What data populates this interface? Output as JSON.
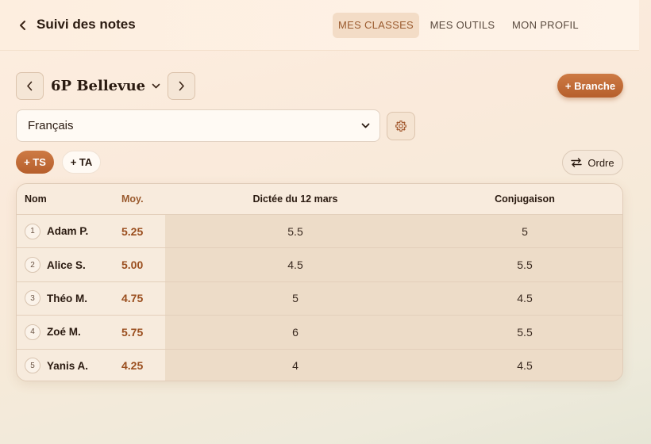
{
  "header": {
    "back_icon": "chevron-left-icon",
    "title": "Suivi des notes",
    "nav": [
      {
        "label": "MES CLASSES",
        "active": true
      },
      {
        "label": "MES OUTILS",
        "active": false
      },
      {
        "label": "MON PROFIL",
        "active": false
      }
    ]
  },
  "class_bar": {
    "class_name": "6P Bellevue",
    "prev_icon": "chevron-left-icon",
    "next_icon": "chevron-right-icon",
    "dropdown_icon": "chevron-down-icon",
    "add_branch_label": "+ Branche"
  },
  "subject": {
    "selected": "Français",
    "settings_icon": "gear-icon"
  },
  "filters": {
    "ts_label": "+ TS",
    "ta_label": "+ TA",
    "order_label": "Ordre",
    "order_icon": "swap-arrows-icon"
  },
  "table": {
    "columns": [
      "Nom",
      "Moy.",
      "Dictée du 12 mars",
      "Conjugaison"
    ],
    "rows": [
      {
        "num": "1",
        "name": "Adam P.",
        "avg": "5.25",
        "a": "5.5",
        "b": "5"
      },
      {
        "num": "2",
        "name": "Alice S.",
        "avg": "5.00",
        "a": "4.5",
        "b": "5.5"
      },
      {
        "num": "3",
        "name": "Théo M.",
        "avg": "4.75",
        "a": "5",
        "b": "4.5"
      },
      {
        "num": "4",
        "name": "Zoé M.",
        "avg": "5.75",
        "a": "6",
        "b": "5.5"
      },
      {
        "num": "5",
        "name": "Yanis A.",
        "avg": "4.25",
        "a": "4",
        "b": "4.5"
      }
    ]
  },
  "colors": {
    "accent": "#c06a36",
    "accent_text": "#9a4e1e",
    "nav_active_bg": "#f3dcc6"
  }
}
